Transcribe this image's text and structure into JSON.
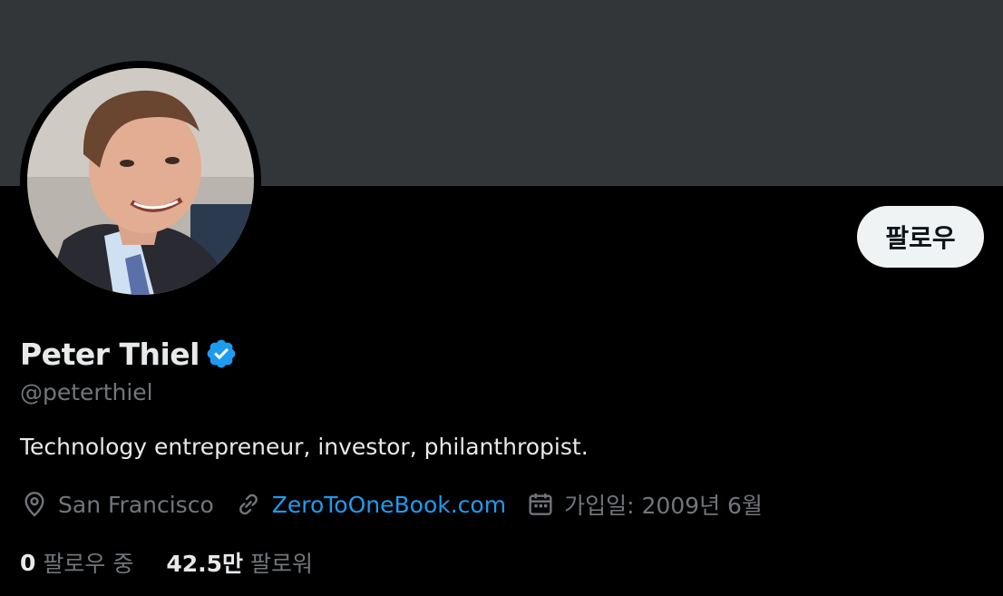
{
  "profile": {
    "name": "Peter Thiel",
    "handle": "@peterthiel",
    "bio": "Technology entrepreneur, investor, philanthropist.",
    "location": "San Francisco",
    "website": "ZeroToOneBook.com",
    "joined": "가입일: 2009년 6월",
    "following_count": "0",
    "following_label": "팔로우 중",
    "followers_count": "42.5만",
    "followers_label": "팔로워"
  },
  "actions": {
    "follow_label": "팔로우"
  },
  "colors": {
    "background": "#000000",
    "banner": "#333639",
    "primary_text": "#e7e9ea",
    "secondary_text": "#71767b",
    "link": "#1d9bf0",
    "button_bg": "#eff3f4"
  },
  "icons": {
    "verified": "verified-badge-icon",
    "location": "location-pin-icon",
    "website": "link-icon",
    "joined": "calendar-icon"
  }
}
